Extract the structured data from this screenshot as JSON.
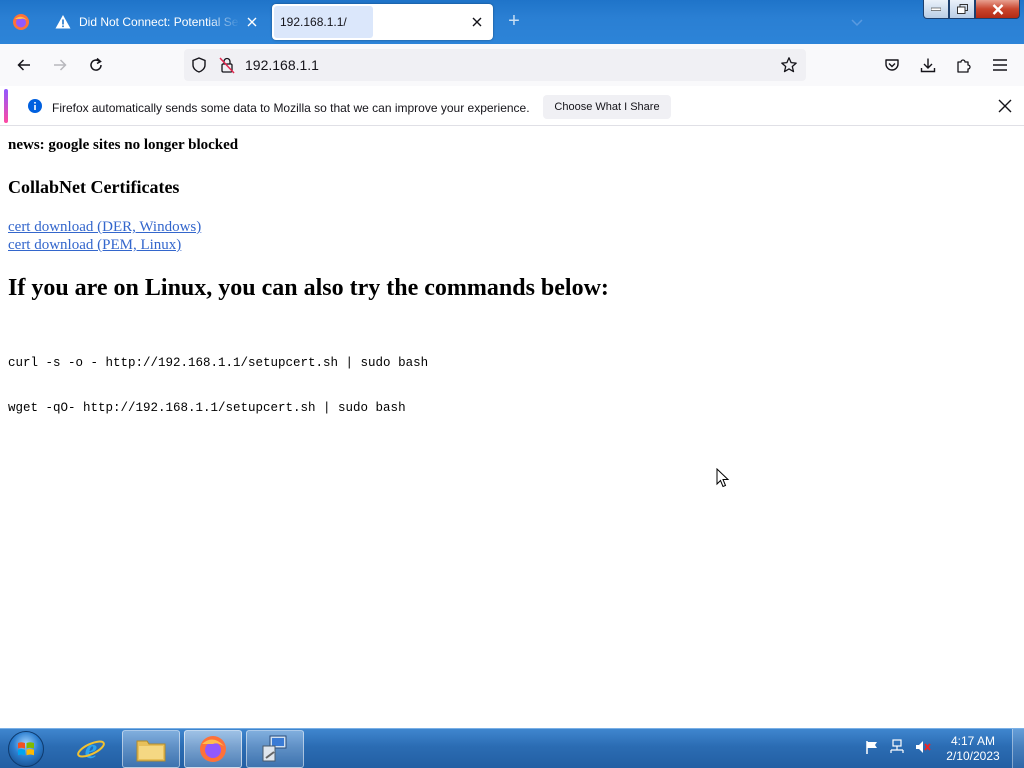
{
  "browser": {
    "tabs": [
      {
        "title": "Did Not Connect: Potential Security Issue",
        "icon": "warning-icon",
        "active": false
      },
      {
        "title": "192.168.1.1/",
        "icon": "none",
        "active": true
      }
    ],
    "url": "192.168.1.1",
    "notification": {
      "message": "Firefox automatically sends some data to Mozilla so that we can improve your experience.",
      "button_label": "Choose What I Share"
    }
  },
  "page": {
    "news": "news: google sites no longer blocked",
    "certs_heading": "CollabNet Certificates",
    "links": [
      {
        "label": "cert download (DER, Windows)"
      },
      {
        "label": "cert download (PEM, Linux)"
      }
    ],
    "linux_heading": "If you are on Linux, you can also try the commands below:",
    "commands": [
      "curl -s -o - http://192.168.1.1/setupcert.sh | sudo bash",
      "wget -qO- http://192.168.1.1/setupcert.sh | sudo bash"
    ]
  },
  "taskbar": {
    "time": "4:17 AM",
    "date": "2/10/2023",
    "items": [
      "internet-explorer-icon",
      "file-explorer-icon",
      "firefox-icon",
      "network-setup-icon"
    ]
  },
  "colors": {
    "titlebar": "#2a7fd3",
    "link": "#3366cc",
    "taskbar": "#2b6cb3"
  }
}
